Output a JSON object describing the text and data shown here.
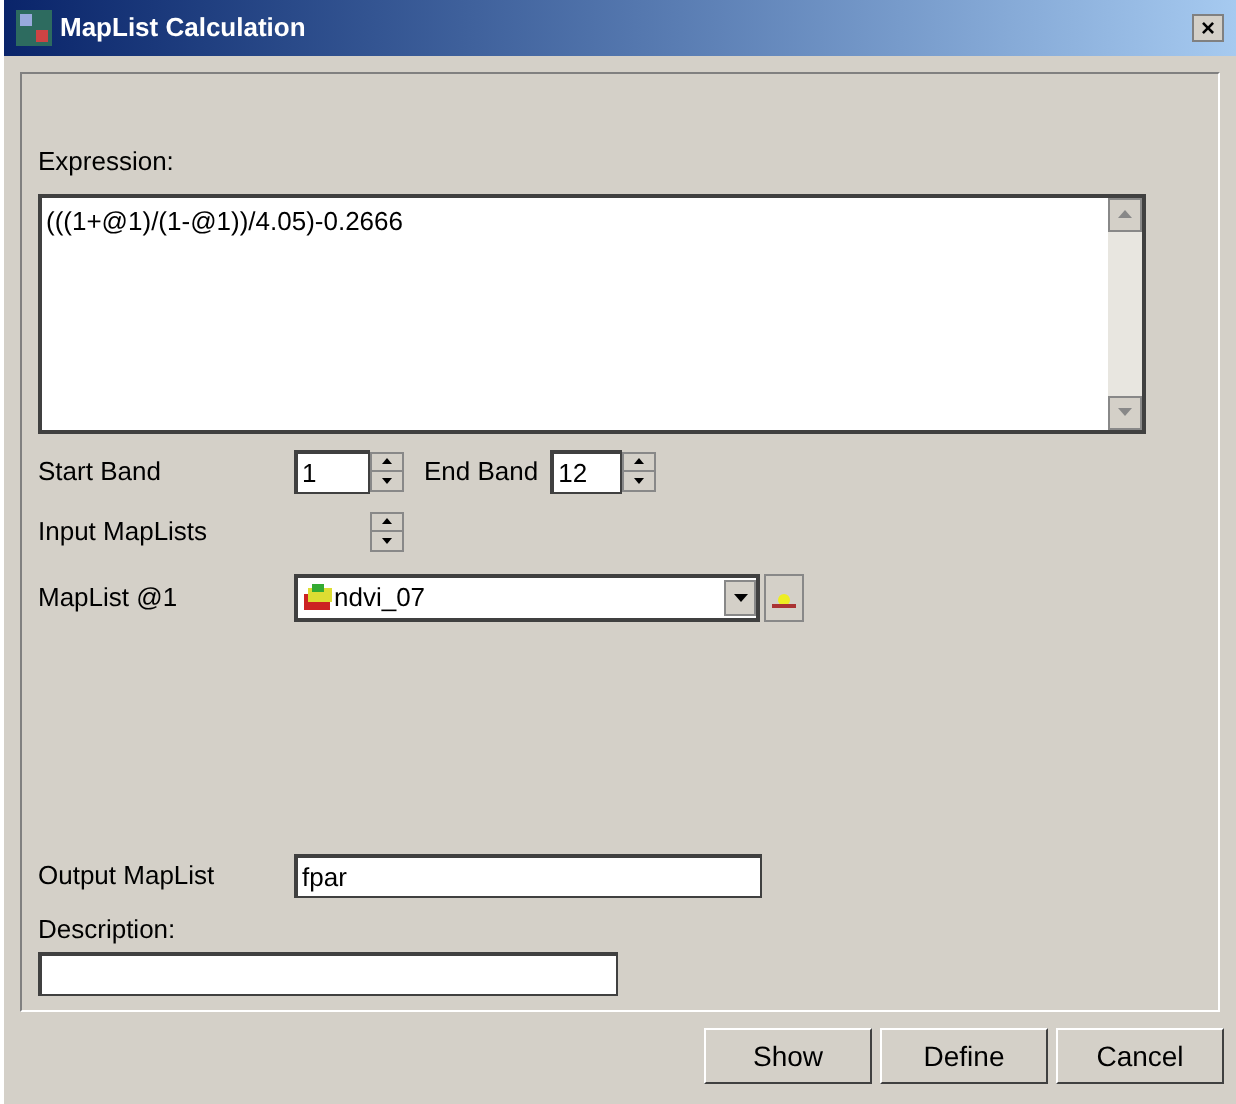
{
  "window": {
    "title": "MapList Calculation",
    "close": "×"
  },
  "expression": {
    "label": "Expression:",
    "value": "(((1+@1)/(1-@1))/4.05)-0.2666"
  },
  "start_band": {
    "label": "Start Band",
    "value": "1"
  },
  "end_band": {
    "label": "End Band",
    "value": "12"
  },
  "input_maplists": {
    "label": "Input MapLists"
  },
  "maplist": {
    "label": "MapList @1",
    "value": "ndvi_07"
  },
  "output_maplist": {
    "label": "Output MapList",
    "value": "fpar"
  },
  "description": {
    "label": "Description:"
  },
  "buttons": [
    "Show",
    "Define",
    "Cancel"
  ]
}
